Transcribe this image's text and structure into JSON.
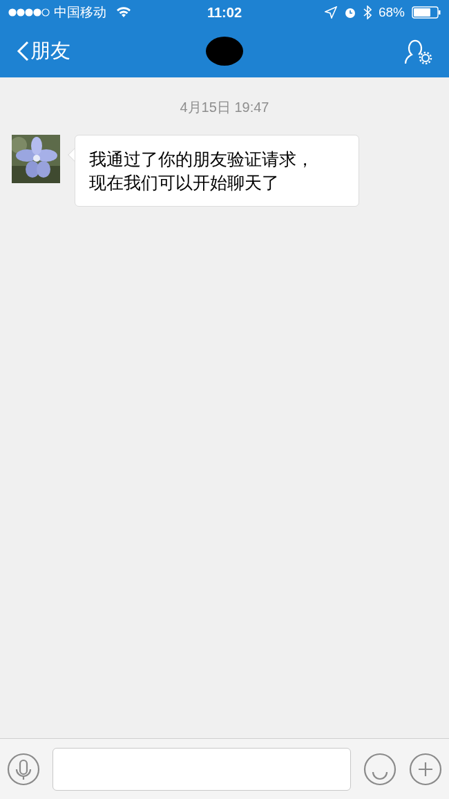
{
  "status_bar": {
    "carrier": "中国移动",
    "time": "11:02",
    "battery": "68%"
  },
  "nav_bar": {
    "back_label": "朋友"
  },
  "chat": {
    "timestamp": "4月15日 19:47",
    "messages": [
      {
        "kind": "incoming",
        "text": "我通过了你的朋友验证请求，现在我们可以开始聊天了"
      }
    ]
  }
}
